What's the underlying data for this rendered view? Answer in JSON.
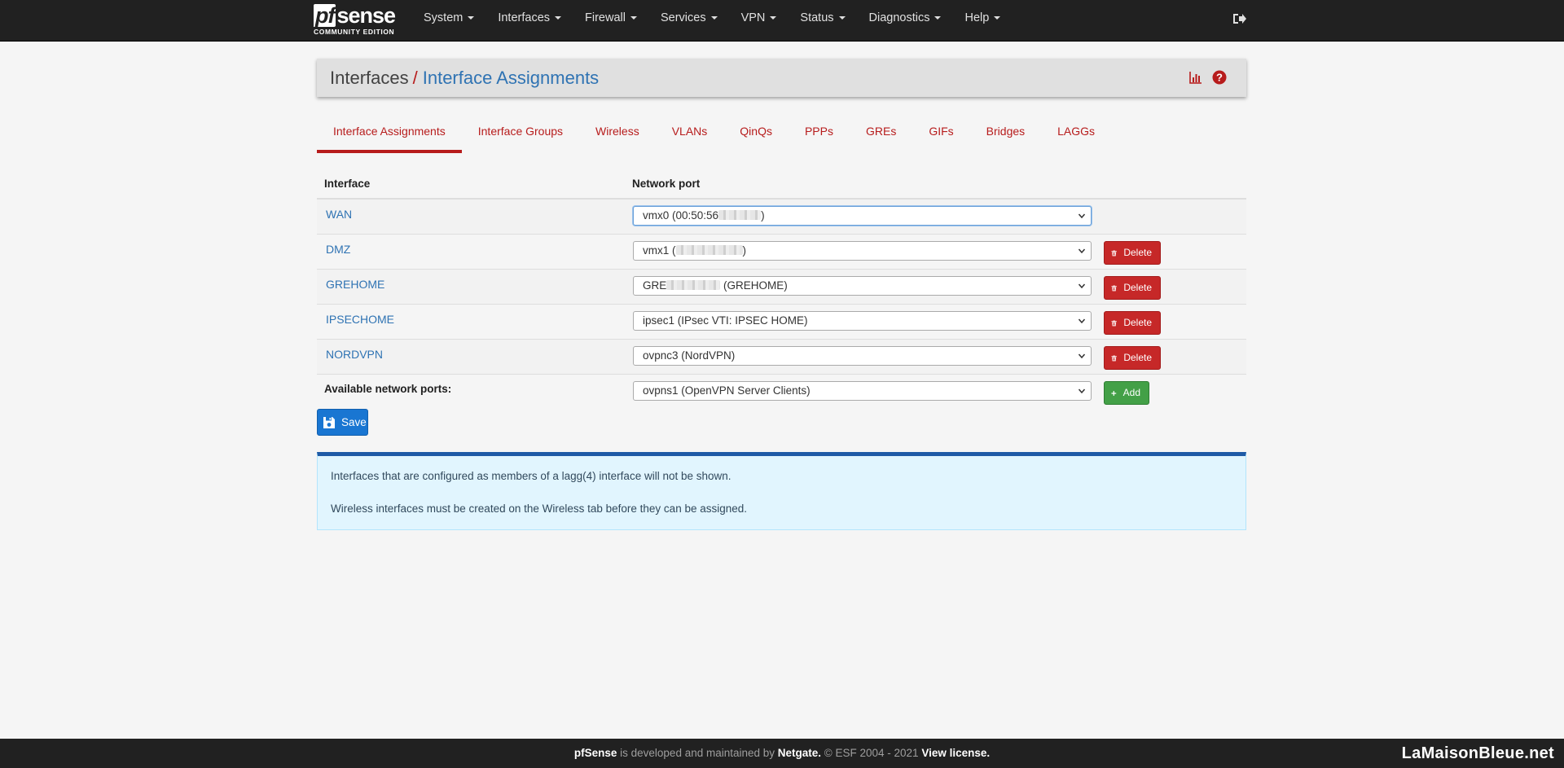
{
  "brand": {
    "logo": "sense",
    "logo_prefix": "pf",
    "subtitle": "COMMUNITY EDITION"
  },
  "nav": [
    "System",
    "Interfaces",
    "Firewall",
    "Services",
    "VPN",
    "Status",
    "Diagnostics",
    "Help"
  ],
  "breadcrumb": {
    "parent": "Interfaces",
    "separator": "/",
    "current": "Interface Assignments"
  },
  "tabs": [
    "Interface Assignments",
    "Interface Groups",
    "Wireless",
    "VLANs",
    "QinQs",
    "PPPs",
    "GREs",
    "GIFs",
    "Bridges",
    "LAGGs"
  ],
  "table": {
    "headers": [
      "Interface",
      "Network port"
    ],
    "rows": [
      {
        "name": "WAN",
        "port_prefix": "vmx0 (00:50:56",
        "port_suffix": ")",
        "deletable": false
      },
      {
        "name": "DMZ",
        "port_prefix": "vmx1 (",
        "port_suffix": ")",
        "deletable": true
      },
      {
        "name": "GREHOME",
        "port_prefix": "GRE",
        "port_suffix": " (GREHOME)",
        "deletable": true
      },
      {
        "name": "IPSECHOME",
        "port_prefix": "ipsec1 (IPsec VTI: IPSEC HOME)",
        "port_suffix": "",
        "deletable": true
      },
      {
        "name": "NORDVPN",
        "port_prefix": "ovpnc3 (NordVPN)",
        "port_suffix": "",
        "deletable": true
      }
    ],
    "available_label": "Available network ports:",
    "available_value": "ovpns1 (OpenVPN Server Clients)"
  },
  "buttons": {
    "delete": "Delete",
    "add": "Add",
    "save": "Save"
  },
  "info": {
    "line1": "Interfaces that are configured as members of a lagg(4) interface will not be shown.",
    "line2": "Wireless interfaces must be created on the Wireless tab before they can be assigned."
  },
  "footer": {
    "brand": "pfSense",
    "text1": " is developed and maintained by ",
    "company": "Netgate.",
    "text2": " © ESF 2004 - 2021 ",
    "license": "View license."
  },
  "watermark": "LaMaisonBleue.net",
  "colors": {
    "navbar": "#212121",
    "accent_red": "#b71c1c",
    "link_blue": "#2f73b3",
    "save_blue": "#1976d2",
    "add_green": "#43a047"
  },
  "icons": [
    "chart-icon",
    "help-icon",
    "logout-icon",
    "trash-icon",
    "plus-icon",
    "save-icon"
  ]
}
